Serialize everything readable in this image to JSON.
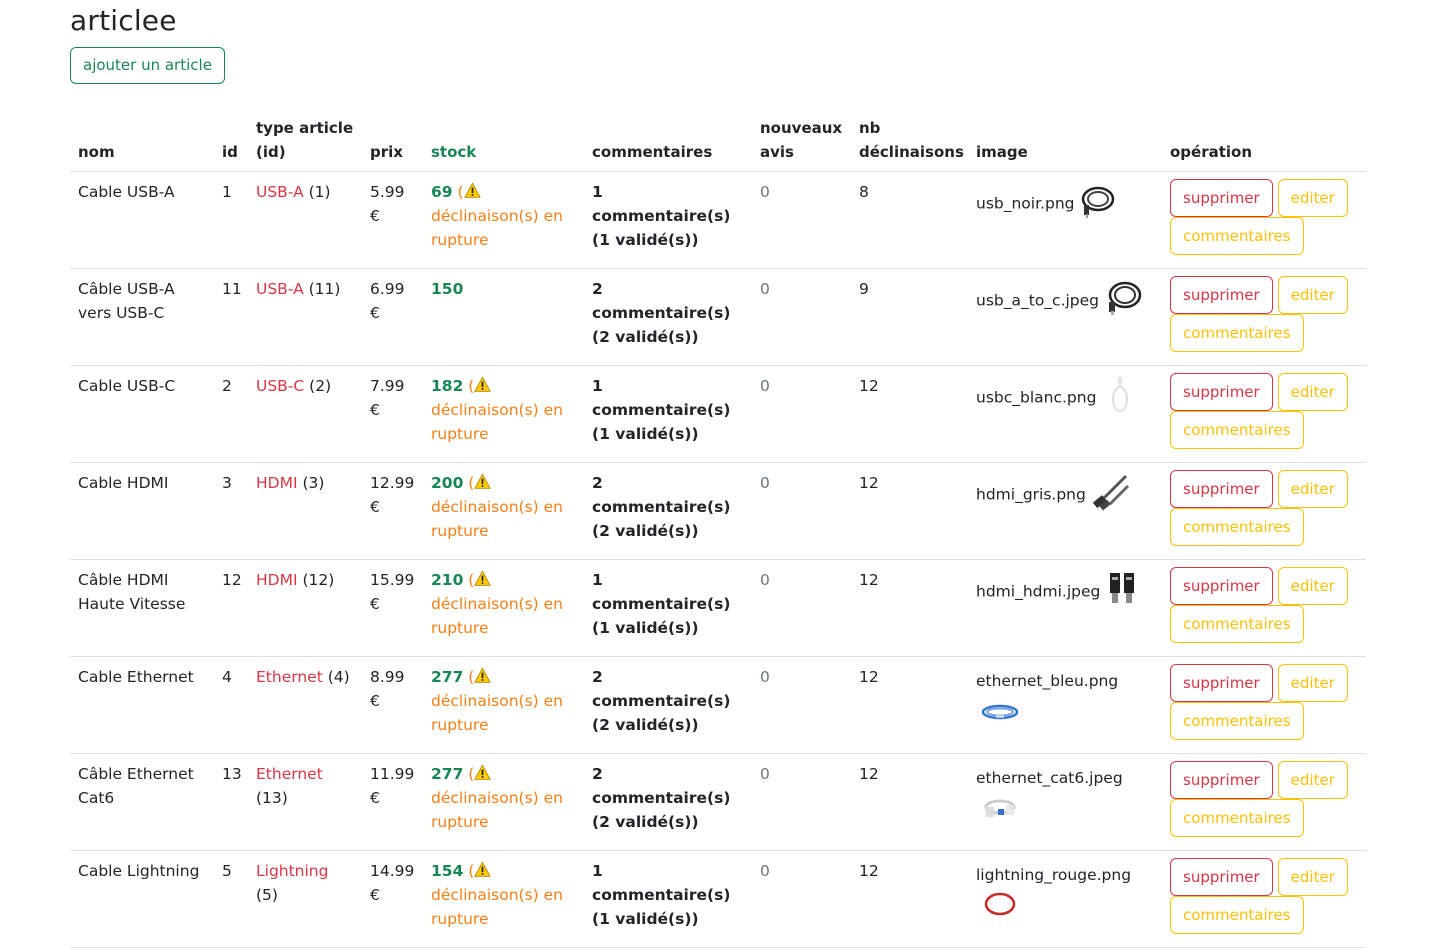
{
  "page": {
    "title": "articlee",
    "add_label": "ajouter un article"
  },
  "table": {
    "headers": {
      "nom": "nom",
      "id": "id",
      "type": "type article (id)",
      "prix": "prix",
      "stock": "stock",
      "commentaires": "commentaires",
      "avis": "nouveaux avis",
      "declinaisons": "nb déclinaisons",
      "image": "image",
      "operation": "opération"
    },
    "buttons": {
      "delete": "supprimer",
      "edit": "editer",
      "comments": "commentaires"
    },
    "warning_text": "déclinaison(s) en rupture",
    "rows": [
      {
        "nom": "Cable USB-A",
        "id": "1",
        "type": "USB-A",
        "type_id": "(1)",
        "prix": "5.99 €",
        "stock": "69",
        "warning": true,
        "commentaires": "1 commentaire(s) (1 validé(s))",
        "avis": "0",
        "declinaisons": "8",
        "image": "usb_noir.png",
        "icon": "black-usb-cable-thumbnail"
      },
      {
        "nom": "Câble USB-A vers USB-C",
        "id": "11",
        "type": "USB-A",
        "type_id": "(11)",
        "prix": "6.99 €",
        "stock": "150",
        "warning": false,
        "commentaires": "2 commentaire(s) (2 validé(s))",
        "avis": "0",
        "declinaisons": "9",
        "image": "usb_a_to_c.jpeg",
        "icon": "usb-a-to-c-cable-thumbnail"
      },
      {
        "nom": "Cable USB-C",
        "id": "2",
        "type": "USB-C",
        "type_id": "(2)",
        "prix": "7.99 €",
        "stock": "182",
        "warning": true,
        "commentaires": "1 commentaire(s) (1 validé(s))",
        "avis": "0",
        "declinaisons": "12",
        "image": "usbc_blanc.png",
        "icon": "white-usb-c-cable-thumbnail"
      },
      {
        "nom": "Cable HDMI",
        "id": "3",
        "type": "HDMI",
        "type_id": "(3)",
        "prix": "12.99 €",
        "stock": "200",
        "warning": true,
        "commentaires": "2 commentaire(s) (2 validé(s))",
        "avis": "0",
        "declinaisons": "12",
        "image": "hdmi_gris.png",
        "icon": "grey-hdmi-cable-thumbnail"
      },
      {
        "nom": "Câble HDMI Haute Vitesse",
        "id": "12",
        "type": "HDMI",
        "type_id": "(12)",
        "prix": "15.99 €",
        "stock": "210",
        "warning": true,
        "commentaires": "1 commentaire(s) (1 validé(s))",
        "avis": "0",
        "declinaisons": "12",
        "image": "hdmi_hdmi.jpeg",
        "icon": "hdmi-connectors-thumbnail"
      },
      {
        "nom": "Cable Ethernet",
        "id": "4",
        "type": "Ethernet",
        "type_id": "(4)",
        "prix": "8.99 €",
        "stock": "277",
        "warning": true,
        "commentaires": "2 commentaire(s) (2 validé(s))",
        "avis": "0",
        "declinaisons": "12",
        "image": "ethernet_bleu.png",
        "icon": "blue-ethernet-cable-thumbnail"
      },
      {
        "nom": "Câble Ethernet Cat6",
        "id": "13",
        "type": "Ethernet",
        "type_id": "(13)",
        "prix": "11.99 €",
        "stock": "277",
        "warning": true,
        "commentaires": "2 commentaire(s) (2 validé(s))",
        "avis": "0",
        "declinaisons": "12",
        "image": "ethernet_cat6.jpeg",
        "icon": "white-ethernet-cat6-thumbnail"
      },
      {
        "nom": "Cable Lightning",
        "id": "5",
        "type": "Lightning",
        "type_id": "(5)",
        "prix": "14.99 €",
        "stock": "154",
        "warning": true,
        "commentaires": "1 commentaire(s) (1 validé(s))",
        "avis": "0",
        "declinaisons": "12",
        "image": "lightning_rouge.png",
        "icon": "red-lightning-cable-thumbnail"
      }
    ]
  }
}
